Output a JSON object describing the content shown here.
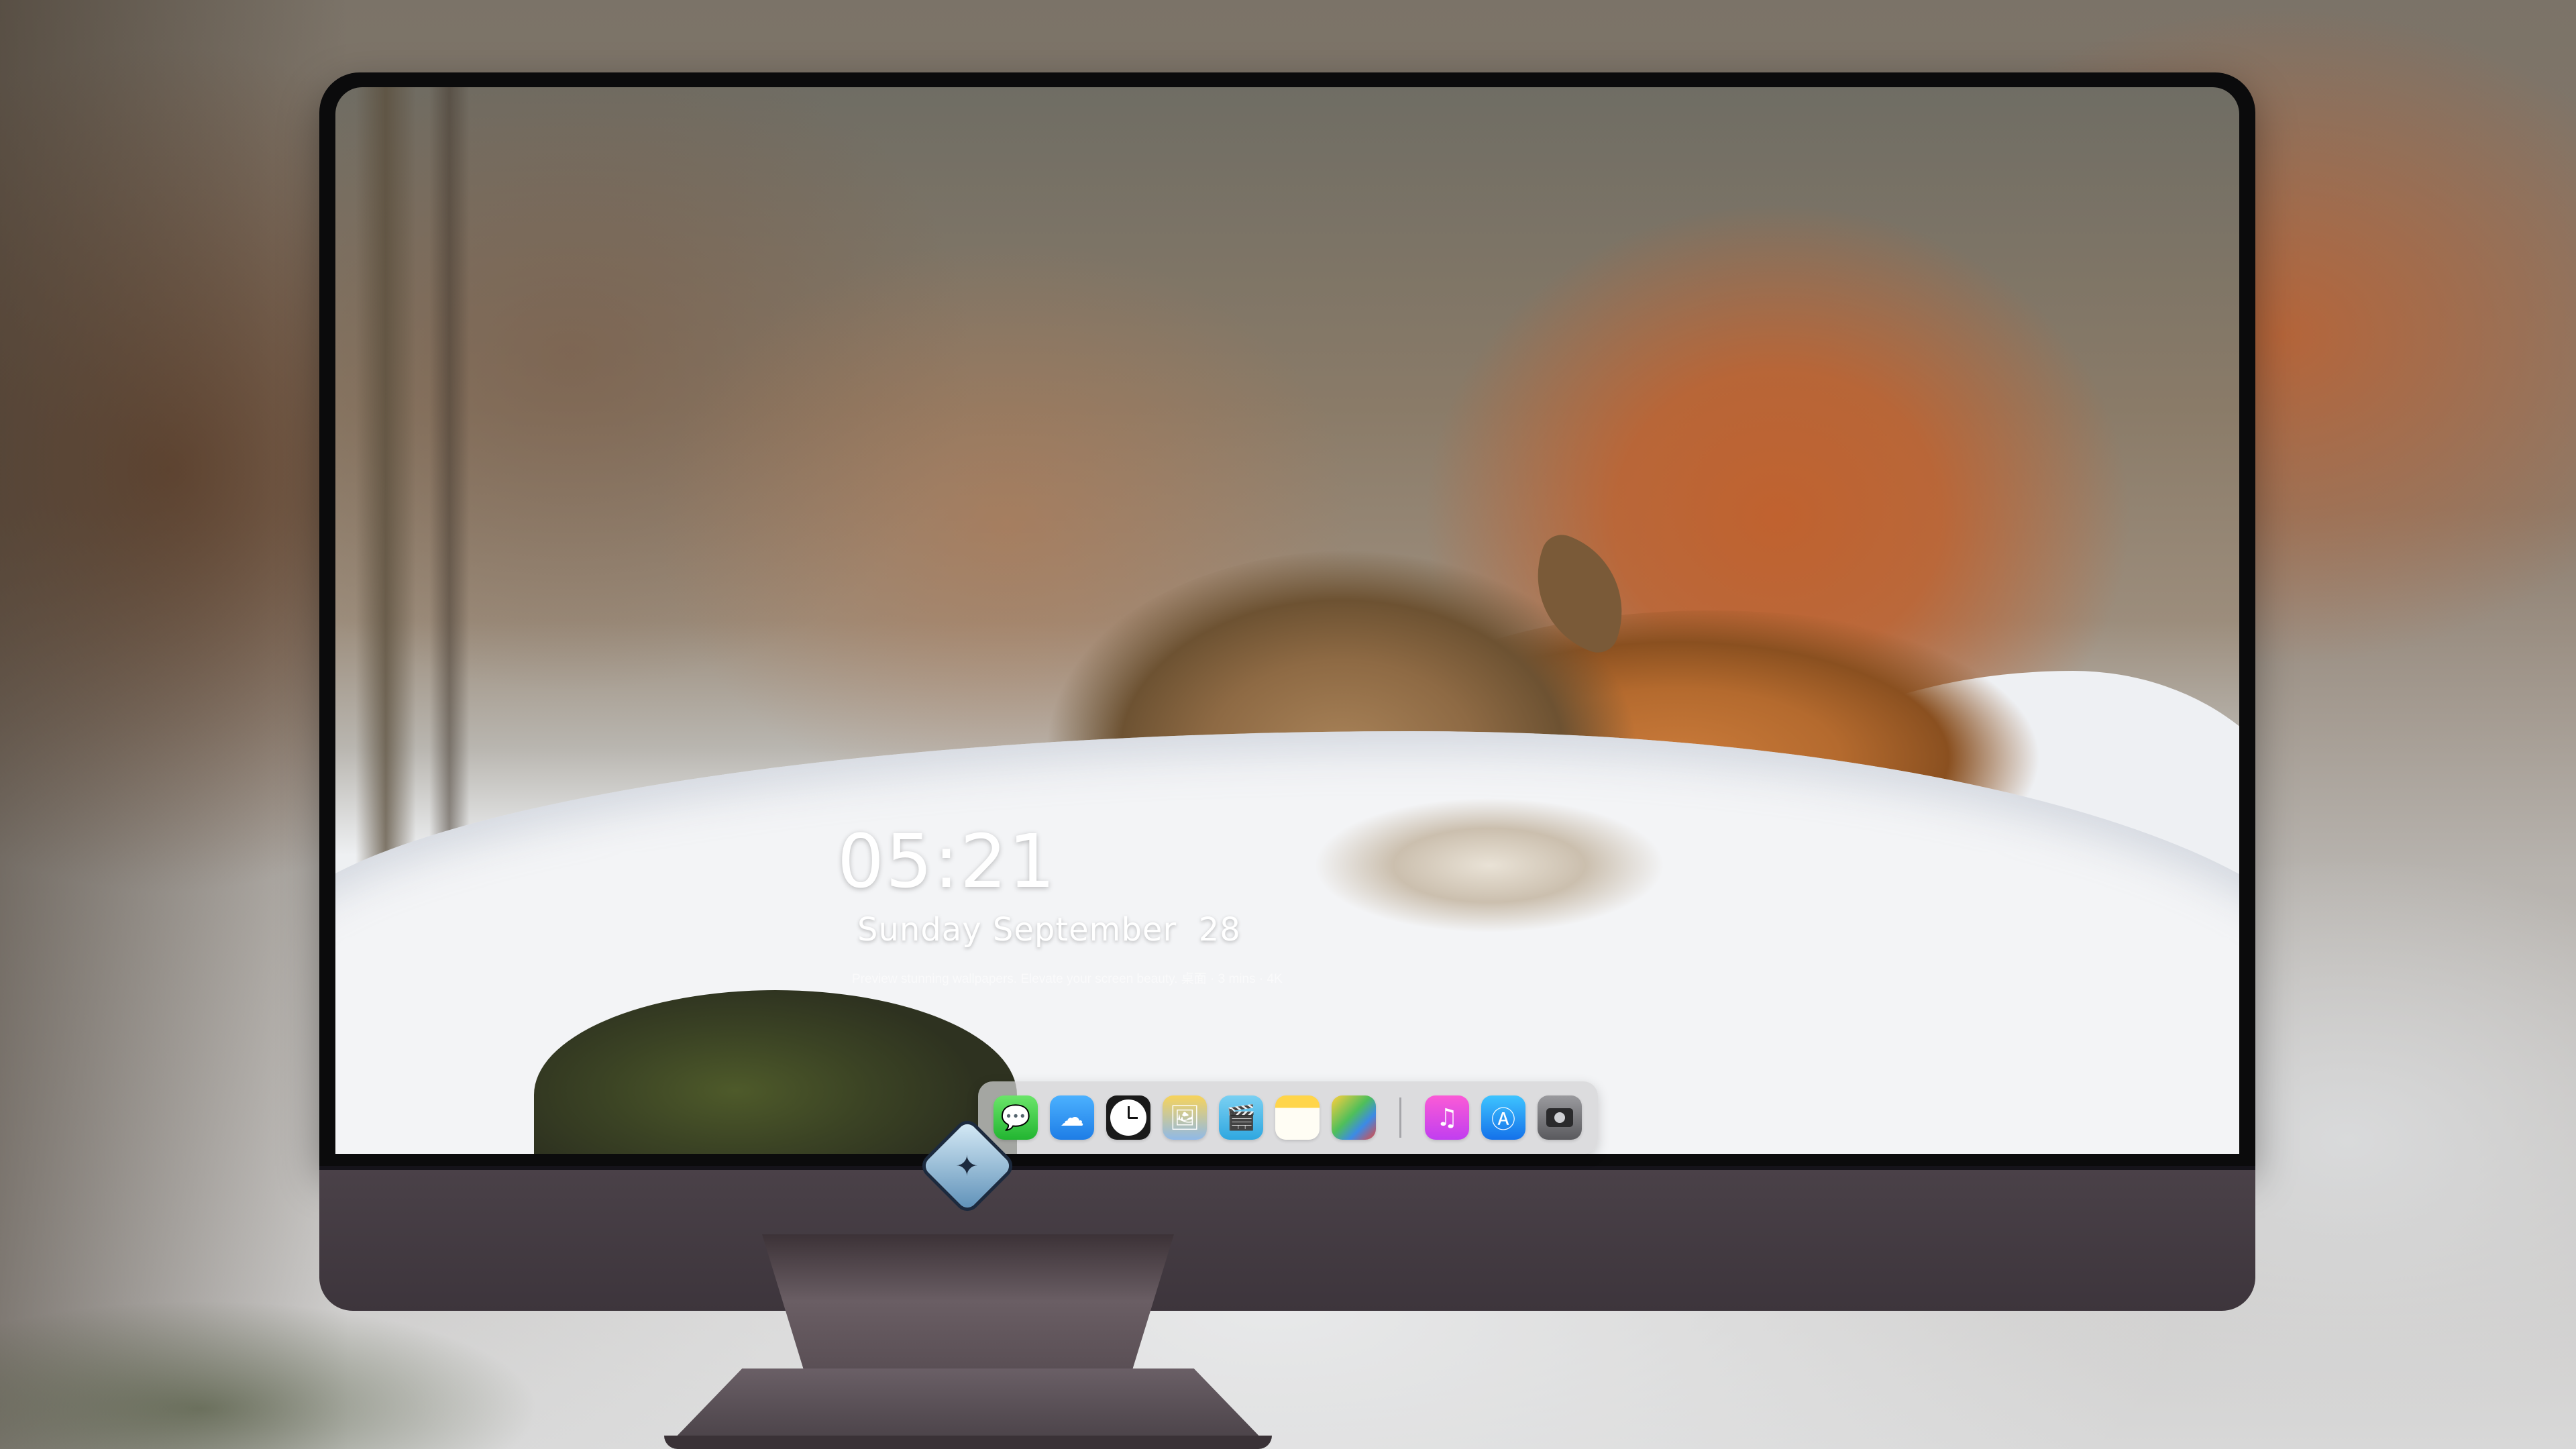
{
  "lock_screen": {
    "time": "05:21",
    "date": "Sunday September  28",
    "tagline": "Preview stunning wallpapers. Elevate your screen beauty. 桌面 · 3 mins · 4K"
  },
  "dock": {
    "apps": [
      {
        "name": "Messages",
        "icon": "message-bubble-icon",
        "glyph": "💬"
      },
      {
        "name": "Weather",
        "icon": "weather-cloud-icon",
        "glyph": "☁"
      },
      {
        "name": "Clock",
        "icon": "clock-icon",
        "glyph": ""
      },
      {
        "name": "Preview",
        "icon": "preview-icon",
        "glyph": "🖼"
      },
      {
        "name": "Clips",
        "icon": "clapperboard-icon",
        "glyph": "🎬"
      },
      {
        "name": "Notes",
        "icon": "notes-icon",
        "glyph": ""
      },
      {
        "name": "Photo Booth",
        "icon": "photos-icon",
        "glyph": ""
      },
      {
        "name": "Music",
        "icon": "music-note-icon",
        "glyph": "♫"
      },
      {
        "name": "App Store",
        "icon": "app-store-icon",
        "glyph": "Ⓐ"
      },
      {
        "name": "Camera",
        "icon": "camera-icon",
        "glyph": ""
      }
    ]
  },
  "colors": {
    "monitor_chin": "#4a4148",
    "bezel": "#0b0b0c",
    "dock_bg": "#d2d2d4",
    "lock_text": "#ffffff"
  }
}
